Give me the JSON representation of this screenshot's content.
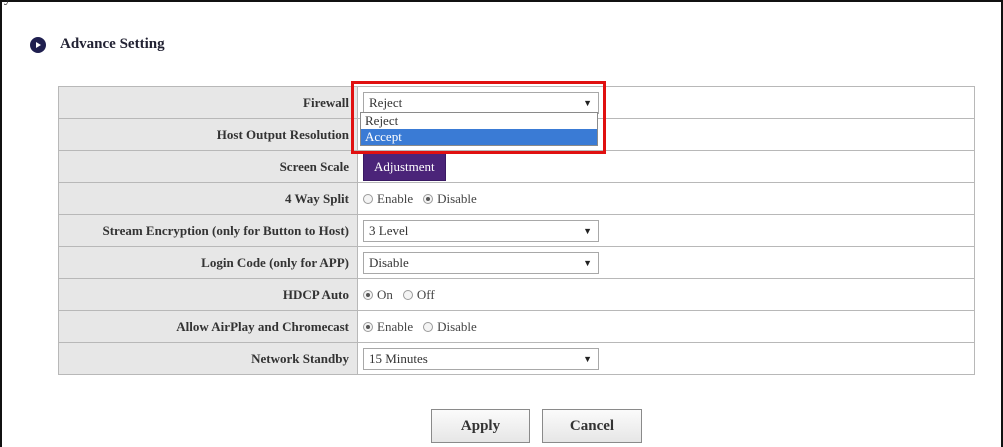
{
  "header": {
    "partial_text": "y"
  },
  "section": {
    "title": "Advance Setting"
  },
  "rows": {
    "firewall": {
      "label": "Firewall",
      "value": "Reject"
    },
    "host_output_resolution": {
      "label": "Host Output Resolution"
    },
    "screen_scale": {
      "label": "Screen Scale",
      "button": "Adjustment"
    },
    "four_way_split": {
      "label": "4 Way Split",
      "options": [
        "Enable",
        "Disable"
      ],
      "selected": "Disable"
    },
    "stream_encryption": {
      "label": "Stream Encryption (only for Button to Host)",
      "value": "3 Level"
    },
    "login_code": {
      "label": "Login Code (only for APP)",
      "value": "Disable"
    },
    "hdcp_auto": {
      "label": "HDCP Auto",
      "options": [
        "On",
        "Off"
      ],
      "selected": "On"
    },
    "airplay_chromecast": {
      "label": "Allow AirPlay and Chromecast",
      "options": [
        "Enable",
        "Disable"
      ],
      "selected": "Enable"
    },
    "network_standby": {
      "label": "Network Standby",
      "value": "15 Minutes"
    }
  },
  "firewall_dropdown": {
    "options": [
      "Reject",
      "Accept"
    ],
    "highlighted": "Accept"
  },
  "actions": {
    "apply": "Apply",
    "cancel": "Cancel"
  },
  "colors": {
    "adjust_button": "#4b2479",
    "highlight_border": "#e01010",
    "dropdown_highlight": "#3a7bd5",
    "label_bg": "#e7e7e7"
  },
  "icons": {
    "section": "play-circle-icon",
    "select_arrow": "chevron-down-icon"
  }
}
